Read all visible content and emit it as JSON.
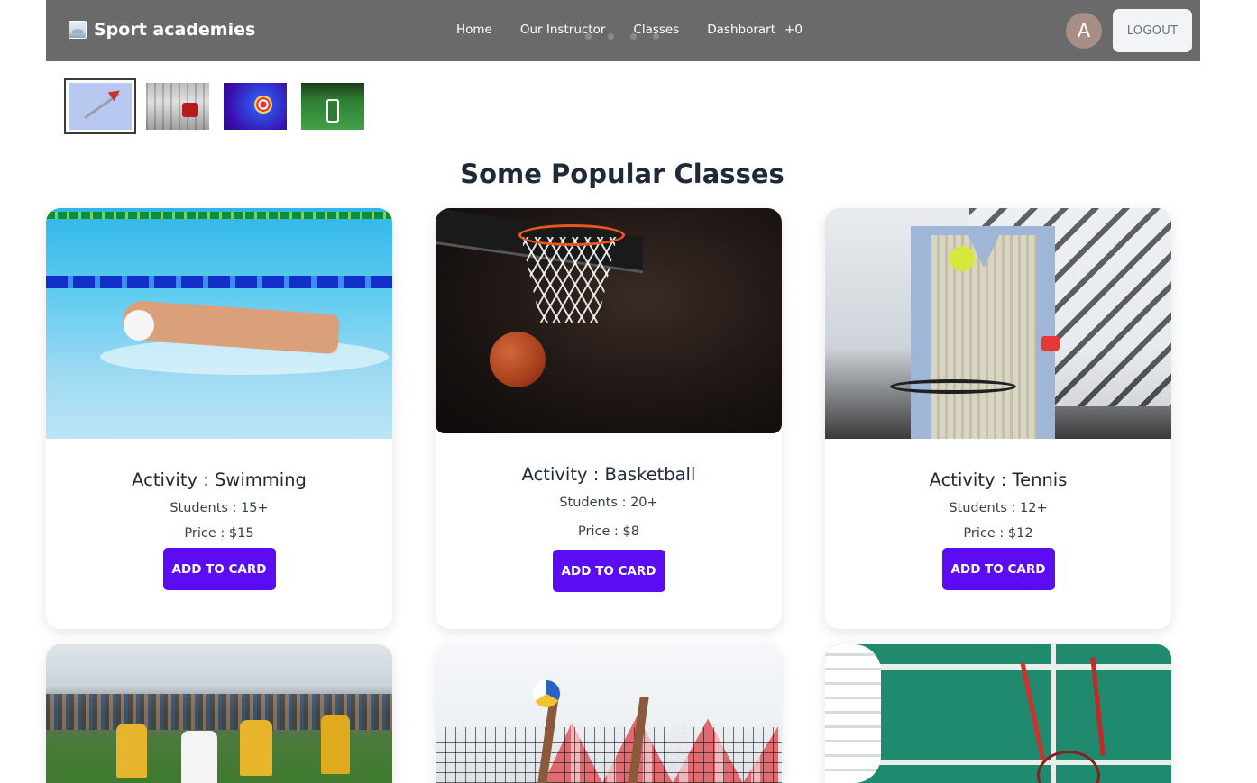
{
  "navbar": {
    "brand": "Sport academies",
    "links": [
      "Home",
      "Our Instructor",
      "Classes",
      "Dashborart"
    ],
    "badge": "+0",
    "avatar_letter": "A",
    "logout_label": "LOGOUT"
  },
  "carousel": {
    "thumbnails": [
      "darts",
      "roller-skates",
      "archery-target",
      "soccer"
    ],
    "active_index": 0
  },
  "section": {
    "title": "Some Popular Classes"
  },
  "classes": [
    {
      "activity": "Activity : Swimming",
      "students": "Students : 15+",
      "price": "Price : $15",
      "button": "ADD TO CARD"
    },
    {
      "activity": "Activity : Basketball",
      "students": "Students : 20+",
      "price": "Price : $8",
      "button": "ADD TO CARD"
    },
    {
      "activity": "Activity : Tennis",
      "students": "Students : 12+",
      "price": "Price : $12",
      "button": "ADD TO CARD"
    }
  ],
  "colors": {
    "navbar_bg": "#6b6a6a",
    "button_primary": "#5b0cf2",
    "avatar_bg": "#a78f86"
  }
}
